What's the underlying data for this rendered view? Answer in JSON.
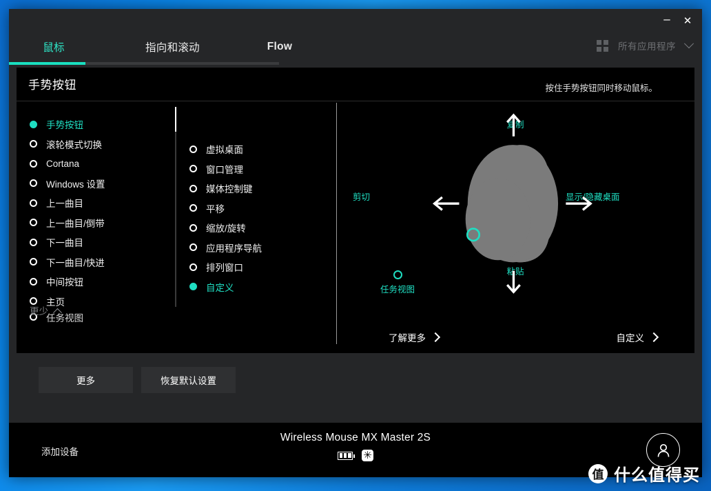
{
  "window": {
    "controls": {
      "minimize": "–",
      "close": "✕"
    }
  },
  "tabs": [
    {
      "label": "鼠标",
      "active": true
    },
    {
      "label": "指向和滚动",
      "active": false
    },
    {
      "label": "Flow",
      "active": false
    }
  ],
  "app_selector": {
    "icon": "grid-icon",
    "label": "所有应用程序",
    "chevron": "chevron-down-icon"
  },
  "card": {
    "title": "手势按钮",
    "hint": "按住手势按钮同时移动鼠标。",
    "left_options": [
      {
        "label": "手势按钮",
        "selected": true
      },
      {
        "label": "滚轮模式切换",
        "selected": false
      },
      {
        "label": "Cortana",
        "selected": false
      },
      {
        "label": "Windows 设置",
        "selected": false
      },
      {
        "label": "上一曲目",
        "selected": false
      },
      {
        "label": "上一曲目/倒带",
        "selected": false
      },
      {
        "label": "下一曲目",
        "selected": false
      },
      {
        "label": "下一曲目/快进",
        "selected": false
      },
      {
        "label": "中间按钮",
        "selected": false
      },
      {
        "label": "主页",
        "selected": false
      },
      {
        "label": "任务视图",
        "selected": false
      }
    ],
    "less_toggle": "更少",
    "middle_options": [
      {
        "label": "虚拟桌面",
        "selected": false
      },
      {
        "label": "窗口管理",
        "selected": false
      },
      {
        "label": "媒体控制键",
        "selected": false
      },
      {
        "label": "平移",
        "selected": false
      },
      {
        "label": "缩放/旋转",
        "selected": false
      },
      {
        "label": "应用程序导航",
        "selected": false
      },
      {
        "label": "排列窗口",
        "selected": false
      },
      {
        "label": "自定义",
        "selected": true
      }
    ],
    "gestures": {
      "up": "复制",
      "down": "粘贴",
      "left": "剪切",
      "right": "显示/隐藏桌面",
      "button_press": "任务视图"
    },
    "footer_links": [
      {
        "label": "了解更多",
        "chevron": "chevron-right-icon"
      },
      {
        "label": "自定义",
        "chevron": "chevron-right-icon"
      }
    ]
  },
  "action_buttons": [
    {
      "label": "更多"
    },
    {
      "label": "恢复默认设置"
    }
  ],
  "statusbar": {
    "add_device": "添加设备",
    "device_name": "Wireless Mouse MX Master 2S",
    "battery_icon": "battery-icon",
    "unifying_icon": "unifying-receiver-icon",
    "avatar_icon": "user-avatar-icon"
  },
  "watermark": {
    "badge": "值",
    "text": "什么值得买"
  },
  "colors": {
    "accent": "#1fdec2",
    "window_bg": "#252628",
    "card_bg": "#000000",
    "button_bg": "#2f3032",
    "desktop": "#0a85e8"
  }
}
